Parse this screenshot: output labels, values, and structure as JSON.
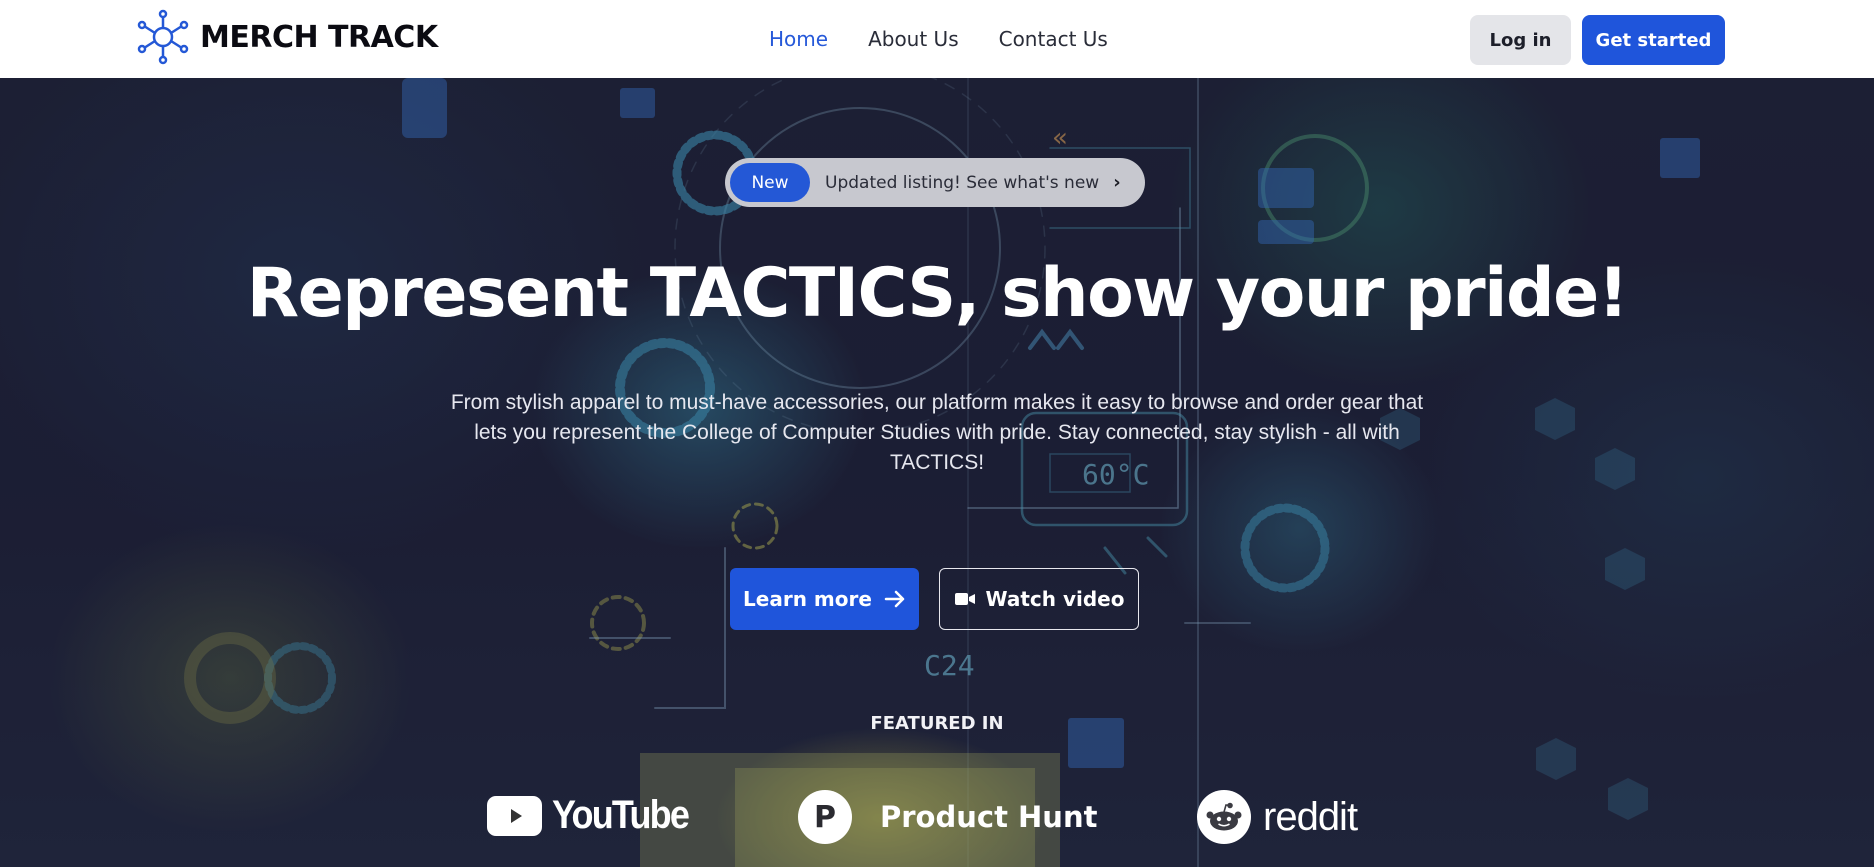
{
  "header": {
    "brand": "MERCH TRACK",
    "nav": [
      {
        "label": "Home",
        "active": true
      },
      {
        "label": "About Us",
        "active": false
      },
      {
        "label": "Contact Us",
        "active": false
      }
    ],
    "login_label": "Log in",
    "get_started_label": "Get started"
  },
  "hero": {
    "badge_tag": "New",
    "badge_text": "Updated listing! See what's new",
    "headline": "Represent TACTICS, show your pride!",
    "subtext": "From stylish apparel to must-have accessories, our platform makes it easy to browse and order gear that lets you represent the College of Computer Studies with pride. Stay connected, stay stylish - all with TACTICS!",
    "learn_more_label": "Learn more",
    "watch_video_label": "Watch video",
    "featured_label": "FEATURED IN",
    "featured": [
      {
        "name": "YouTube",
        "icon": "youtube-icon"
      },
      {
        "name": "Product Hunt",
        "icon": "product-hunt-icon"
      },
      {
        "name": "reddit",
        "icon": "reddit-icon"
      }
    ],
    "background_decor_text": [
      "60°C",
      "C24"
    ]
  },
  "colors": {
    "accent": "#1f55db",
    "nav_active": "#2659d9",
    "hero_bg": "#1e2238"
  }
}
